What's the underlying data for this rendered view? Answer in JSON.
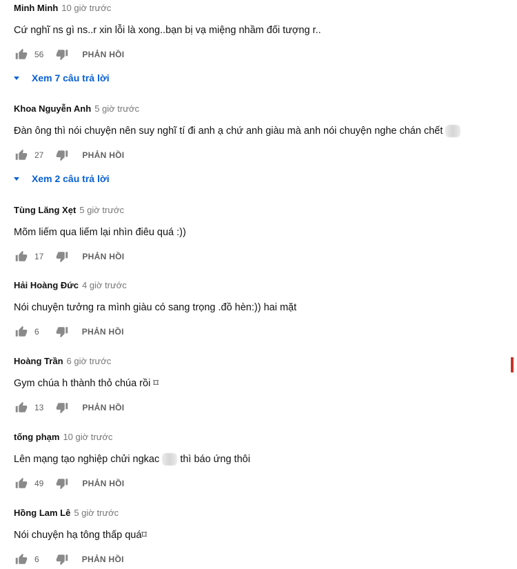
{
  "comments": [
    {
      "author": "Minh Minh",
      "time": "10 giờ trước",
      "text": "Cứ nghĩ ns gì ns..r xin lỗi là xong..bạn bị vạ miệng nhầm đối tượng r..",
      "likes": "56",
      "reply_label": "PHẢN HỒI",
      "view_replies": "Xem 7 câu trả lời"
    },
    {
      "author": "Khoa Nguyễn Anh",
      "time": "5 giờ trước",
      "text": "Đàn ông thì nói chuyện nên suy nghĩ tí đi anh ạ chứ anh giàu mà anh nói chuyện nghe chán chết",
      "likes": "27",
      "reply_label": "PHẢN HỒI",
      "view_replies": "Xem 2 câu trả lời"
    },
    {
      "author": "Tùng Lăng Xẹt",
      "time": "5 giờ trước",
      "text": "Mõm liếm qua liếm lại nhìn điêu quá :))",
      "likes": "17",
      "reply_label": "PHẢN HỒI"
    },
    {
      "author": "Hải Hoàng Đức",
      "time": "4 giờ trước",
      "text": "Nói chuyện tưởng ra mình giàu có sang trọng .đồ hèn:)) hai mặt",
      "likes": "6",
      "reply_label": "PHẢN HỒI"
    },
    {
      "author": "Hoàng Trần",
      "time": "6 giờ trước",
      "text": "Gym chúa h thành thỏ chúa rồi ⌑",
      "likes": "13",
      "reply_label": "PHẢN HỒI"
    },
    {
      "author": "tống phạm",
      "time": "10 giờ trước",
      "text_before": "Lên mạng tạo nghiệp chửi ngkac",
      "text_after": "thì báo ứng thôi",
      "likes": "49",
      "reply_label": "PHẢN HỒI"
    },
    {
      "author": "Hồng Lam Lê",
      "time": "5 giờ trước",
      "text": "Nói chuyện hạ tông thấp quá⌑",
      "likes": "6",
      "reply_label": "PHẢN HỒI"
    }
  ],
  "colors": {
    "link": "#065fd4",
    "muted": "#606060",
    "accent_edge": "#c8322a"
  },
  "icons": {
    "like": "thumb-up-icon",
    "dislike": "thumb-down-icon",
    "expand": "caret-down-icon"
  }
}
